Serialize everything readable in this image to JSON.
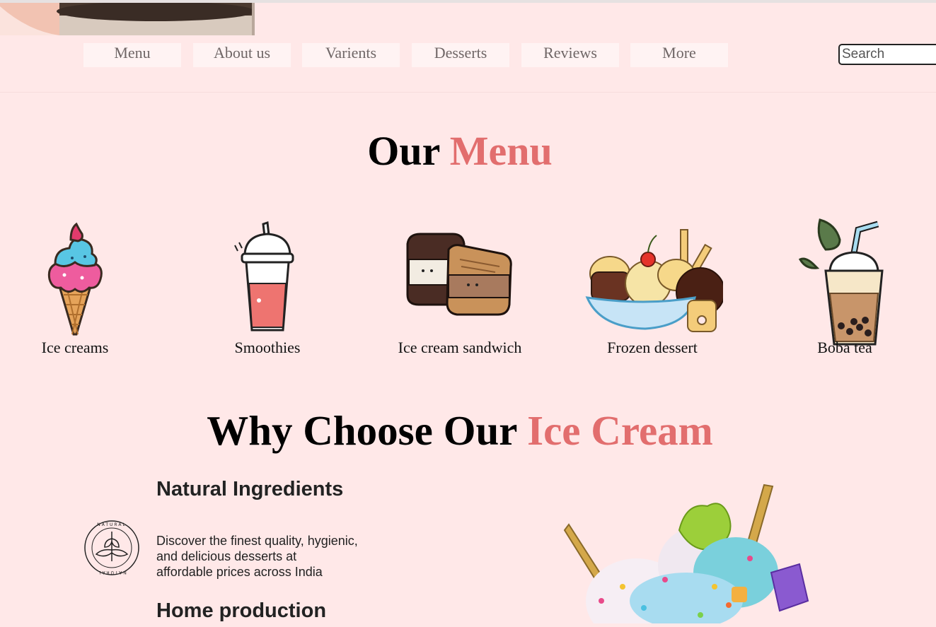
{
  "nav": {
    "items": [
      "Menu",
      "About us",
      "Varients",
      "Desserts",
      "Reviews",
      "More"
    ]
  },
  "search": {
    "placeholder": "Search"
  },
  "menu_section": {
    "title_prefix": "Our",
    "title_accent": "Menu",
    "items": [
      {
        "label": "Ice creams",
        "icon": "ice-cream-cone-icon"
      },
      {
        "label": "Smoothies",
        "icon": "smoothie-cup-icon"
      },
      {
        "label": "Ice cream sandwich",
        "icon": "ice-cream-sandwich-icon"
      },
      {
        "label": "Frozen dessert",
        "icon": "sundae-bowl-icon"
      },
      {
        "label": "Boba tea",
        "icon": "boba-tea-icon"
      }
    ]
  },
  "why_section": {
    "title_prefix": "Why Choose Our",
    "title_accent": "Ice Cream",
    "features": [
      {
        "heading": "Natural Ingredients",
        "text_lines": [
          "Discover the finest quality, hygienic,",
          "and delicious desserts at",
          "affordable prices across India"
        ],
        "badge_text": "NATURAL"
      },
      {
        "heading": "Home production"
      }
    ]
  },
  "colors": {
    "background": "#ffe8e8",
    "accent": "#e26e6e",
    "nav_button": "#fff3f3"
  }
}
